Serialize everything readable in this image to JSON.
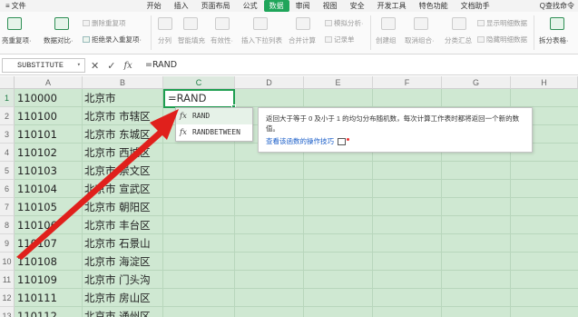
{
  "menu": {
    "file_label": "文件",
    "tabs": [
      "开始",
      "插入",
      "页面布局",
      "公式",
      "数据",
      "审阅",
      "视图",
      "安全",
      "开发工具",
      "特色功能",
      "文档助手"
    ],
    "active_tab": "数据",
    "search_label": "Q查找命令"
  },
  "ribbon": {
    "highlight_dup": "亮重复项·",
    "data_compare": "数据对比·",
    "delete_dup": "删除重复项",
    "reject_dup": "拒绝录入重复项·",
    "split": "分列",
    "smart_fill": "智能填充",
    "validity": "有效性·",
    "insert_dropdown": "插入下拉列表",
    "consolidate": "合并计算",
    "simulate": "模拟分析·",
    "record": "记录单",
    "create_group": "创建组",
    "ungroup": "取消组合·",
    "subtotal": "分类汇总",
    "show_detail": "显示明细数据",
    "hide_detail": "隐藏明细数据",
    "split_table": "拆分表格·"
  },
  "formula_bar": {
    "name_box": "SUBSTITUTE",
    "cancel": "✕",
    "confirm": "✓",
    "fx": "fx",
    "formula": "=RAND"
  },
  "columns": [
    "A",
    "B",
    "C",
    "D",
    "E",
    "F",
    "G",
    "H"
  ],
  "rows": [
    {
      "num": "1",
      "a": "110000",
      "b": "北京市"
    },
    {
      "num": "2",
      "a": "110100",
      "b": "北京市 市辖区"
    },
    {
      "num": "3",
      "a": "110101",
      "b": "北京市 东城区"
    },
    {
      "num": "4",
      "a": "110102",
      "b": "北京市 西城区"
    },
    {
      "num": "5",
      "a": "110103",
      "b": "北京市 崇文区"
    },
    {
      "num": "6",
      "a": "110104",
      "b": "北京市 宣武区"
    },
    {
      "num": "7",
      "a": "110105",
      "b": "北京市 朝阳区"
    },
    {
      "num": "8",
      "a": "110106",
      "b": "北京市 丰台区"
    },
    {
      "num": "9",
      "a": "110107",
      "b": "北京市 石景山"
    },
    {
      "num": "10",
      "a": "110108",
      "b": "北京市 海淀区"
    },
    {
      "num": "11",
      "a": "110109",
      "b": "北京市 门头沟"
    },
    {
      "num": "12",
      "a": "110111",
      "b": "北京市 房山区"
    },
    {
      "num": "13",
      "a": "110112",
      "b": "北京市 通州区"
    }
  ],
  "active_cell": {
    "ref": "C1",
    "value": "=RAND"
  },
  "autocomplete": {
    "items": [
      {
        "icon": "fx",
        "name": "RAND"
      },
      {
        "icon": "fx",
        "name": "RANDBETWEEN"
      }
    ]
  },
  "tooltip": {
    "description": "返回大于等于 0 及小于 1 的均匀分布随机数，每次计算工作表时都将返回一个新的数值。",
    "link": "查看该函数的操作技巧"
  },
  "colors": {
    "accent": "#1fa55a",
    "sheet_bg": "#cfe8d2",
    "arrow": "#e0201c"
  }
}
